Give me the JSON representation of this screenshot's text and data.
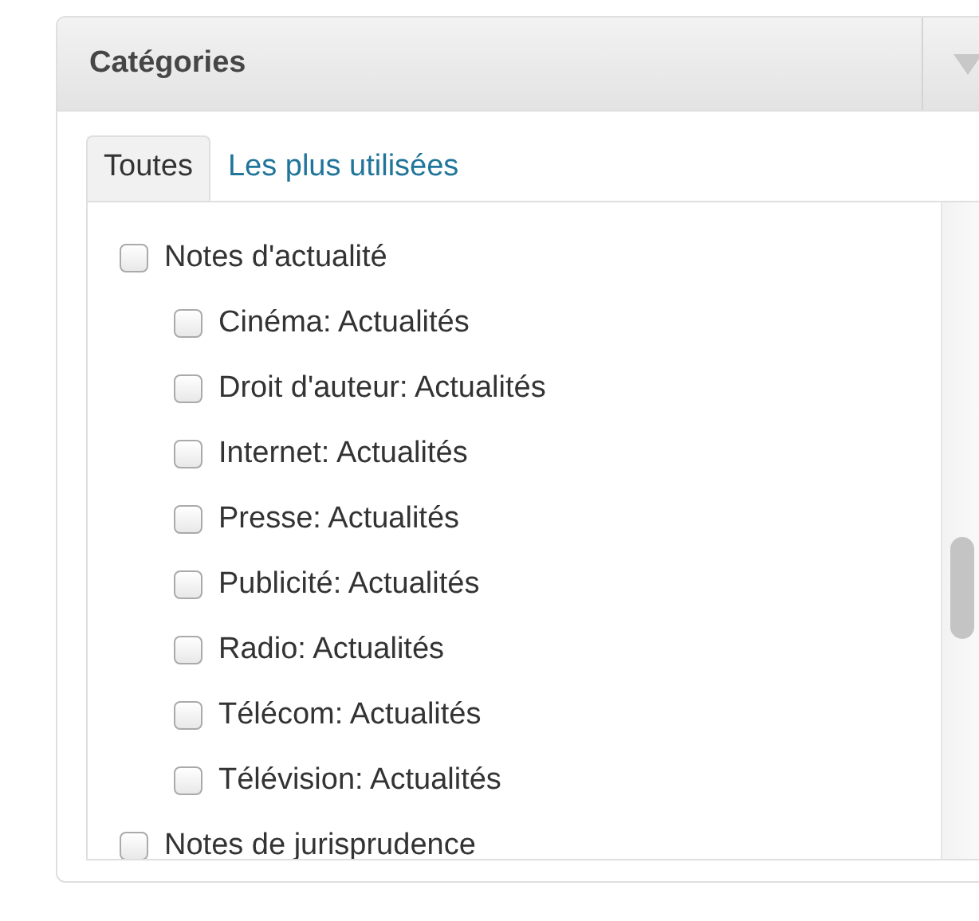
{
  "panel": {
    "title": "Catégories"
  },
  "tabs": [
    {
      "label": "Toutes",
      "selected": true
    },
    {
      "label": "Les plus utilisées",
      "selected": false
    }
  ],
  "categories": [
    {
      "label": "Notes d'actualité",
      "checked": false,
      "children": [
        {
          "label": "Cinéma: Actualités",
          "checked": false
        },
        {
          "label": "Droit d'auteur: Actualités",
          "checked": false
        },
        {
          "label": "Internet: Actualités",
          "checked": false
        },
        {
          "label": "Presse: Actualités",
          "checked": false
        },
        {
          "label": "Publicité: Actualités",
          "checked": false
        },
        {
          "label": "Radio: Actualités",
          "checked": false
        },
        {
          "label": "Télécom: Actualités",
          "checked": false
        },
        {
          "label": "Télévision: Actualités",
          "checked": false
        }
      ]
    },
    {
      "label": "Notes de jurisprudence",
      "checked": false
    }
  ]
}
